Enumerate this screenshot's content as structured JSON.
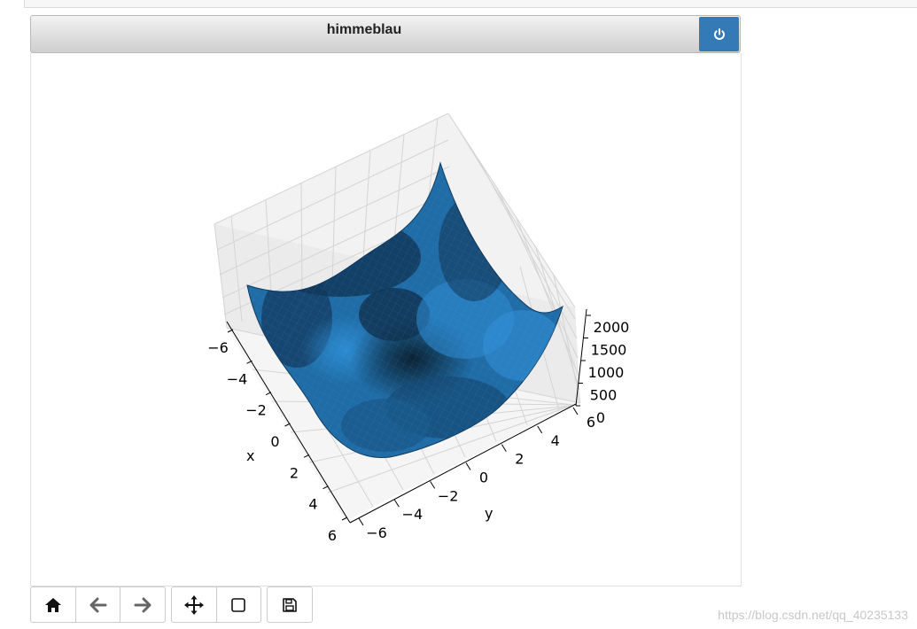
{
  "figure": {
    "title": "himmeblau",
    "close_icon": "power-icon",
    "accent_color": "#337ab7"
  },
  "plot": {
    "surface_color": "#2b7bb9",
    "x_axis": {
      "label": "x",
      "ticks": [
        "−6",
        "−4",
        "−2",
        "0",
        "2",
        "4",
        "6"
      ]
    },
    "y_axis": {
      "label": "y",
      "ticks": [
        "−6",
        "−4",
        "−2",
        "0",
        "2",
        "4",
        "6"
      ]
    },
    "z_axis": {
      "ticks": [
        "0",
        "500",
        "1000",
        "1500",
        "2000"
      ]
    }
  },
  "toolbar": {
    "buttons": [
      {
        "name": "home",
        "icon": "home-icon"
      },
      {
        "name": "back",
        "icon": "arrow-left-icon"
      },
      {
        "name": "forward",
        "icon": "arrow-right-icon"
      },
      {
        "name": "pan",
        "icon": "move-icon"
      },
      {
        "name": "zoom",
        "icon": "square-icon"
      },
      {
        "name": "save",
        "icon": "floppy-disk-icon"
      }
    ]
  },
  "watermark": "https://blog.csdn.net/qq_40235133"
}
